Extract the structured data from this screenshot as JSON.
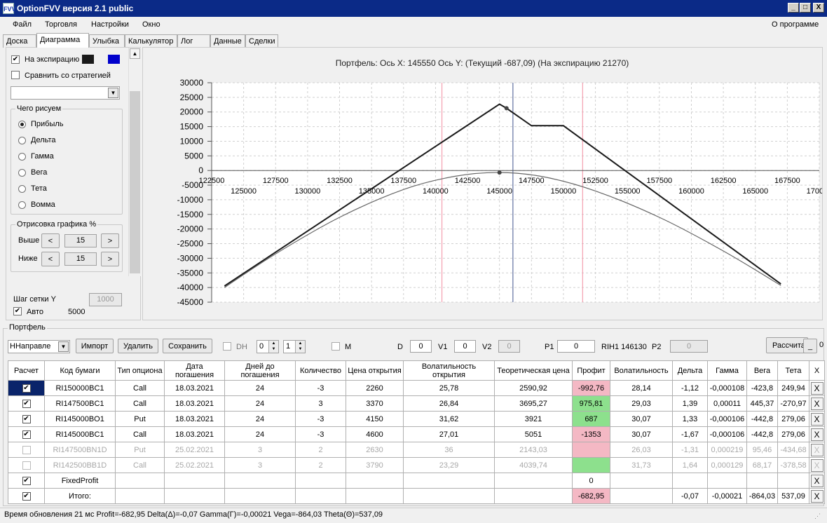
{
  "window": {
    "title": "OptionFVV версия 2.1 public",
    "app_icon": "FVV",
    "minimize_glyph": "_",
    "maximize_glyph": "□",
    "close_glyph": "X"
  },
  "menu": {
    "items": [
      "Файл",
      "Торговля",
      "Настройки",
      "Окно"
    ],
    "about": "О программе"
  },
  "tabs": [
    "Доска",
    "Диаграмма",
    "Улыбка",
    "Калькулятор",
    "Лог",
    "Данные",
    "Сделки"
  ],
  "active_tab": "Диаграмма",
  "left_panel": {
    "expiry_checkbox": {
      "label": "На экспирацию",
      "checked": true,
      "swatch_colors": [
        "#1a1a1a",
        "#0000cc"
      ]
    },
    "compare_checkbox": {
      "label": "Сравнить со стратегией",
      "checked": false
    },
    "strategy_select_value": "",
    "what_group": {
      "caption": "Чего рисуем",
      "options": [
        "Прибыль",
        "Дельта",
        "Гамма",
        "Вега",
        "Тета",
        "Вомма"
      ],
      "selected": "Прибыль"
    },
    "draw_group": {
      "caption": "Отрисовка графика %",
      "above_label": "Выше",
      "below_label": "Ниже",
      "above_value": "15",
      "below_value": "15",
      "dec": "<",
      "inc": ">"
    },
    "grid_step_label": "Шаг сетки Y",
    "grid_step_value": "1000",
    "auto_checkbox": {
      "label": "Авто",
      "checked": true
    },
    "auto_value": "5000",
    "check_mark": "✔"
  },
  "chart_data": {
    "type": "line",
    "title": "Портфель: Ось X: 145550 Ось Y:  (Текущий -687,09)  (На экспирацию 21270)",
    "xlim": [
      122500,
      170000
    ],
    "ylim": [
      -45000,
      30000
    ],
    "y_ticks": [
      "30000",
      "25000",
      "20000",
      "15000",
      "10000",
      "5000",
      "0",
      "-5000",
      "-10000",
      "-15000",
      "-20000",
      "-25000",
      "-30000",
      "-35000",
      "-40000",
      "-45000"
    ],
    "x_ticks_upper": [
      "122500",
      "127500",
      "132500",
      "137500",
      "142500",
      "147500",
      "152500",
      "157500",
      "162500",
      "167500"
    ],
    "x_ticks_lower": [
      "125000",
      "130000",
      "135000",
      "140000",
      "145000",
      "150000",
      "155000",
      "160000",
      "165000",
      "170000"
    ],
    "grid": true,
    "series": [
      {
        "color": "#1a1a1a",
        "x": [
          123500,
          145000,
          145550,
          147500,
          150000,
          167000
        ],
        "y": [
          -39500,
          22700,
          21270,
          15300,
          15300,
          -38800
        ]
      },
      {
        "color": "#666666",
        "x": [
          123500,
          127500,
          132500,
          137500,
          141500,
          145000,
          148500,
          152500,
          157500,
          162500,
          167000
        ],
        "y": [
          -40000,
          -28500,
          -16000,
          -6500,
          -2000,
          -687,
          -2200,
          -7000,
          -16000,
          -27500,
          -39300
        ]
      }
    ],
    "markers": [
      {
        "x": 145550,
        "y": 21270
      },
      {
        "x": 145000,
        "y": -687
      }
    ],
    "vertical_lines": [
      {
        "x": 140500,
        "color": "#f4a0b0"
      },
      {
        "x": 146050,
        "color": "#6070a0"
      },
      {
        "x": 151500,
        "color": "#f4a0b0"
      }
    ]
  },
  "portfolio": {
    "caption": "Портфель",
    "direction_select": "ННаправле",
    "buttons": {
      "import": "Импорт",
      "delete": "Удалить",
      "save": "Сохранить",
      "calc": "Рассчита",
      "mini": "_"
    },
    "dh": {
      "label": "DH",
      "checked": false,
      "spin1": "0",
      "spin2": "1"
    },
    "m": {
      "label": "M",
      "checked": false
    },
    "d": {
      "label": "D",
      "value": "0"
    },
    "v1": {
      "label": "V1",
      "value": "0"
    },
    "v2": {
      "label": "V2",
      "value": "0"
    },
    "p1": {
      "label": "P1",
      "value": "0"
    },
    "rih": "RIH1 146130",
    "p2": {
      "label": "P2",
      "value": "0"
    },
    "side_value": "0"
  },
  "table": {
    "headers": [
      "Расчет",
      "Код бумаги",
      "Тип опциона",
      "Дата погашения",
      "Дней до погашения",
      "Количество",
      "Цена открытия",
      "Волатильность открытия",
      "Теоретическая цена",
      "Профит",
      "Волатильность",
      "Дельта",
      "Гамма",
      "Вега",
      "Тета",
      "X"
    ],
    "rows": [
      {
        "check": true,
        "disabled": false,
        "cells": [
          "RI150000BC1",
          "Call",
          "18.03.2021",
          "24",
          "-3",
          "2260",
          "25,78",
          "2590,92",
          "-992,76",
          "28,14",
          "-1,12",
          "-0,000108",
          "-423,8",
          "249,94"
        ],
        "profit_color": "#f4b8c4"
      },
      {
        "check": true,
        "disabled": false,
        "cells": [
          "RI147500BC1",
          "Call",
          "18.03.2021",
          "24",
          "3",
          "3370",
          "26,84",
          "3695,27",
          "975,81",
          "29,03",
          "1,39",
          "0,00011",
          "445,37",
          "-270,97"
        ],
        "profit_color": "#8de08d"
      },
      {
        "check": true,
        "disabled": false,
        "cells": [
          "RI145000BO1",
          "Put",
          "18.03.2021",
          "24",
          "-3",
          "4150",
          "31,62",
          "3921",
          "687",
          "30,07",
          "1,33",
          "-0,000106",
          "-442,8",
          "279,06"
        ],
        "profit_color": "#8de08d"
      },
      {
        "check": true,
        "disabled": false,
        "cells": [
          "RI145000BC1",
          "Call",
          "18.03.2021",
          "24",
          "-3",
          "4600",
          "27,01",
          "5051",
          "-1353",
          "30,07",
          "-1,67",
          "-0,000106",
          "-442,8",
          "279,06"
        ],
        "profit_color": "#f4b8c4"
      },
      {
        "check": false,
        "disabled": true,
        "cells": [
          "RI147500BN1D",
          "Put",
          "25.02.2021",
          "3",
          "2",
          "2630",
          "36",
          "2143,03",
          "",
          "26,03",
          "-1,31",
          "0,000219",
          "95,46",
          "-434,68"
        ],
        "profit_color": "#f4b8c4"
      },
      {
        "check": false,
        "disabled": true,
        "cells": [
          "RI142500BB1D",
          "Call",
          "25.02.2021",
          "3",
          "2",
          "3790",
          "23,29",
          "4039,74",
          "",
          "31,73",
          "1,64",
          "0,000129",
          "68,17",
          "-378,58"
        ],
        "profit_color": "#8de08d"
      },
      {
        "check": true,
        "disabled": false,
        "cells": [
          "FixedProfit",
          "",
          "",
          "",
          "",
          "",
          "",
          "",
          "0",
          "",
          "",
          "",
          "",
          ""
        ],
        "profit_color": "#ffffff"
      },
      {
        "check": true,
        "disabled": false,
        "cells": [
          "Итого:",
          "",
          "",
          "",
          "",
          "",
          "",
          "",
          "-682,95",
          "",
          "-0,07",
          "-0,00021",
          "-864,03",
          "537,09"
        ],
        "profit_color": "#f4b8c4"
      }
    ],
    "delete_glyph": "X",
    "check_glyph": "✔"
  },
  "status": {
    "text": "Время обновления 21 мс  Profit=-682,95 Delta(Δ)=-0,07 Gamma(Γ)=-0,00021 Vega=-864,03 Theta(Θ)=537,09"
  }
}
